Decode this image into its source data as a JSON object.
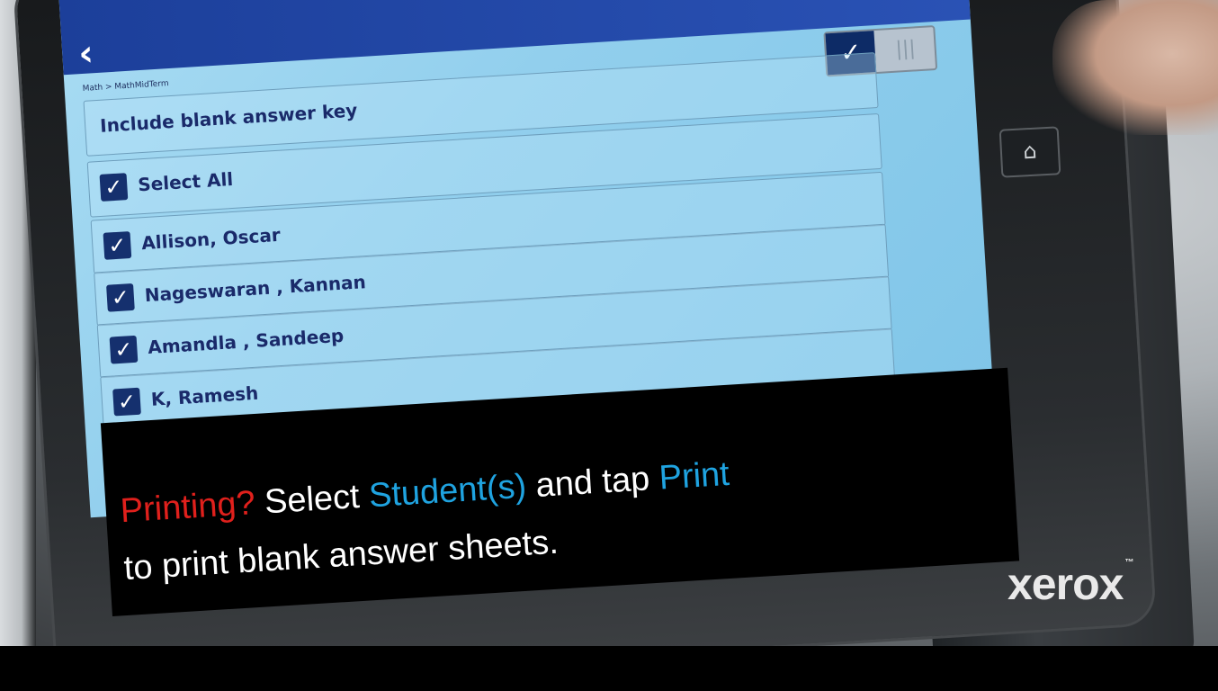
{
  "screen": {
    "breadcrumb": "Math > MathMidTerm",
    "toggle": {
      "on_icon": "check-icon",
      "off_icon": "grip-icon"
    },
    "include_blank_label": "Include blank answer key",
    "select_all_label": "Select All",
    "students": [
      {
        "name": "Allison, Oscar"
      },
      {
        "name": "Nageswaran , Kannan"
      },
      {
        "name": "Amandla , Sandeep"
      },
      {
        "name": "K, Ramesh"
      }
    ]
  },
  "caption": {
    "line1_part1": "Printing?",
    "line1_part2": " Select ",
    "line1_part3": "Student(s)",
    "line1_part4": " and tap ",
    "line1_part5": "Print",
    "line2": "to print blank answer sheets."
  },
  "brand": {
    "name": "xerox",
    "tm": "™"
  },
  "colors": {
    "caption_red": "#e0201c",
    "caption_blue": "#1fa3e0",
    "topbar": "#1c3f9a"
  }
}
